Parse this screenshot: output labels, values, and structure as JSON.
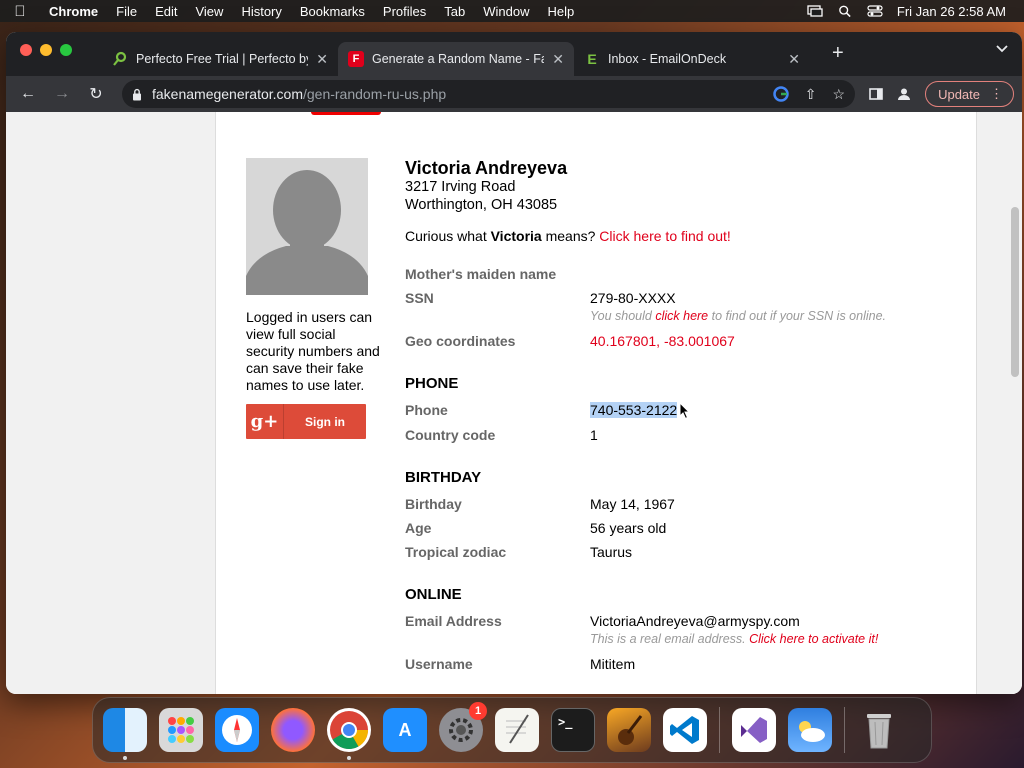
{
  "menubar": {
    "app": "Chrome",
    "items": [
      "File",
      "Edit",
      "View",
      "History",
      "Bookmarks",
      "Profiles",
      "Tab",
      "Window",
      "Help"
    ],
    "clock": "Fri Jan 26  2:58 AM"
  },
  "tabs": [
    {
      "title": "Perfecto Free Trial | Perfecto by",
      "favicon": "perfecto-icon",
      "active": false
    },
    {
      "title": "Generate a Random Name - Fa",
      "favicon": "fakename-icon",
      "active": true
    },
    {
      "title": "Inbox - EmailOnDeck",
      "favicon": "emailondeck-icon",
      "active": false
    }
  ],
  "toolbar": {
    "url_host": "fakenamegenerator.com",
    "url_path": "/gen-random-ru-us.php",
    "update_label": "Update"
  },
  "sidebar": {
    "login_text": "Logged in users can view full social security numbers and can save their fake names to use later.",
    "gplus_icon": "g+",
    "signin_label": "Sign in"
  },
  "identity": {
    "name": "Victoria Andreyeva",
    "street": "3217 Irving Road",
    "city": "Worthington, OH 43085",
    "curious_prefix": "Curious what ",
    "first_name": "Victoria",
    "curious_suffix": " means? ",
    "curious_link": "Click here to find out!"
  },
  "fields": {
    "maiden_label": "Mother's maiden name",
    "ssn_label": "SSN",
    "ssn_value": "279-80-XXXX",
    "ssn_note_prefix": "You should ",
    "ssn_note_link": "click here",
    "ssn_note_suffix": " to find out if your SSN is online.",
    "geo_label": "Geo coordinates",
    "geo_value": "40.167801, -83.001067"
  },
  "phone": {
    "heading": "PHONE",
    "phone_label": "Phone",
    "phone_value": "740-553-2122",
    "country_label": "Country code",
    "country_value": "1"
  },
  "birthday": {
    "heading": "BIRTHDAY",
    "birthday_label": "Birthday",
    "birthday_value": "May 14, 1967",
    "age_label": "Age",
    "age_value": "56 years old",
    "zodiac_label": "Tropical zodiac",
    "zodiac_value": "Taurus"
  },
  "online": {
    "heading": "ONLINE",
    "email_label": "Email Address",
    "email_value": "VictoriaAndreyeva@armyspy.com",
    "email_note_prefix": "This is a real email address. ",
    "email_note_link": "Click here to activate it!",
    "username_label": "Username",
    "username_value": "Mititem"
  },
  "dock": {
    "apps": [
      "finder",
      "launchpad",
      "safari",
      "firefox",
      "chrome",
      "app-store",
      "system-settings",
      "textedit",
      "terminal",
      "garageband",
      "vscode",
      "visual-studio",
      "weather",
      "trash"
    ],
    "settings_badge": "1"
  }
}
